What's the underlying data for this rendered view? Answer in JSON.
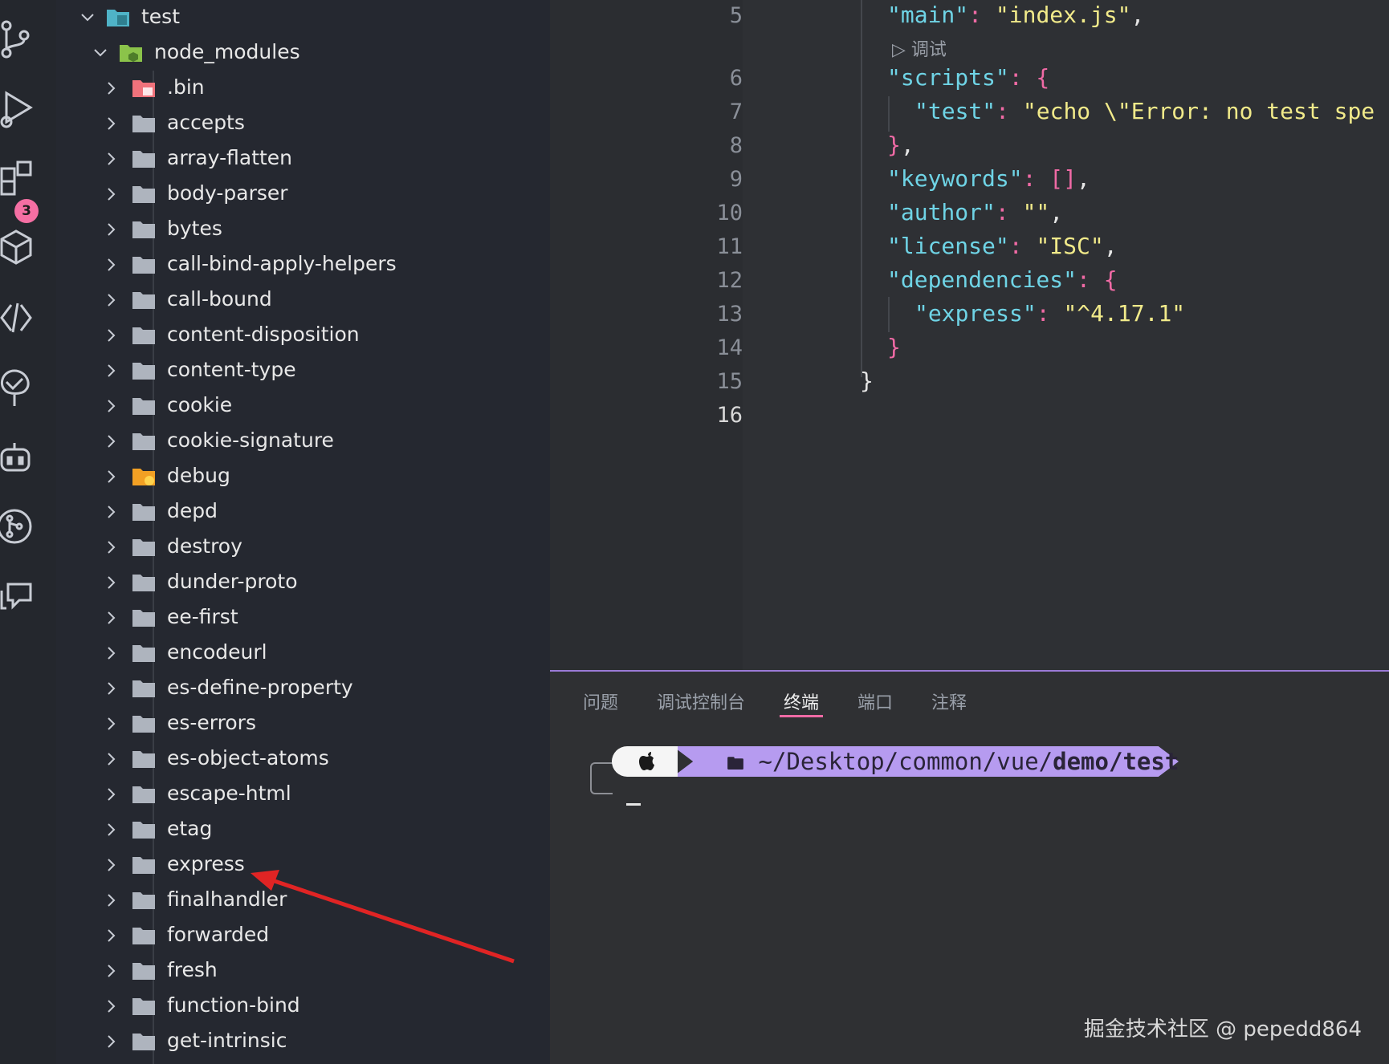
{
  "explorer": {
    "root": "test",
    "node_modules": "node_modules",
    "items": [
      ".bin",
      "accepts",
      "array-flatten",
      "body-parser",
      "bytes",
      "call-bind-apply-helpers",
      "call-bound",
      "content-disposition",
      "content-type",
      "cookie",
      "cookie-signature",
      "debug",
      "depd",
      "destroy",
      "dunder-proto",
      "ee-first",
      "encodeurl",
      "es-define-property",
      "es-errors",
      "es-object-atoms",
      "escape-html",
      "etag",
      "express",
      "finalhandler",
      "forwarded",
      "fresh",
      "function-bind",
      "get-intrinsic"
    ]
  },
  "activity": {
    "badge": "3"
  },
  "editor": {
    "codelens": "调试",
    "line_numbers": [
      "5",
      "6",
      "7",
      "8",
      "9",
      "10",
      "11",
      "12",
      "13",
      "14",
      "15",
      "16"
    ]
  },
  "panel": {
    "tabs": [
      "问题",
      "调试控制台",
      "终端",
      "端口",
      "注释"
    ],
    "active_tab": "终端",
    "prompt_path_prefix": "~/Desktop/common/vue/",
    "prompt_path_bold": "demo/test"
  },
  "colors": {
    "accent_pink": "#f06aa5",
    "prompt_purple": "#b69bf0",
    "annotation_red": "#e02424"
  },
  "watermark": "掘金技术社区 @ pepedd864"
}
